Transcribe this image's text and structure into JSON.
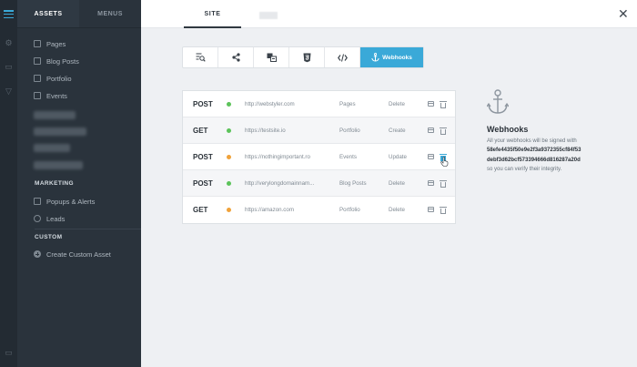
{
  "sidebar": {
    "tabs": [
      {
        "label": "ASSETS",
        "active": true
      },
      {
        "label": "MENUS",
        "active": false
      }
    ],
    "items": [
      {
        "label": "Pages",
        "icon": "page-icon"
      },
      {
        "label": "Blog Posts",
        "icon": "blog-icon"
      },
      {
        "label": "Portfolio",
        "icon": "portfolio-icon"
      },
      {
        "label": "Events",
        "icon": "calendar-icon"
      }
    ],
    "marketing_heading": "MARKETING",
    "marketing_items": [
      {
        "label": "Popups & Alerts",
        "icon": "popup-icon"
      },
      {
        "label": "Leads",
        "icon": "leads-icon"
      }
    ],
    "custom_heading": "CUSTOM",
    "custom_items": [
      {
        "label": "Create Custom Asset",
        "icon": "plus-circle-icon"
      }
    ]
  },
  "topbar": {
    "tab_site": "SITE",
    "close_glyph": "✕"
  },
  "toolbar": {
    "buttons": [
      {
        "icon": "search-doc-icon"
      },
      {
        "icon": "share-icon"
      },
      {
        "icon": "translate-icon"
      },
      {
        "icon": "css3-icon"
      },
      {
        "icon": "code-icon"
      },
      {
        "icon": "anchor-icon",
        "label": "Webhooks",
        "active": true
      }
    ]
  },
  "webhooks": {
    "rows": [
      {
        "method": "POST",
        "status": "green",
        "url": "http://webstyler.com",
        "asset": "Pages",
        "event": "Delete"
      },
      {
        "method": "GET",
        "status": "green",
        "url": "https://testsite.io",
        "asset": "Portfolio",
        "event": "Create"
      },
      {
        "method": "POST",
        "status": "orange",
        "url": "https://nothingimportant.ro",
        "asset": "Events",
        "event": "Update"
      },
      {
        "method": "POST",
        "status": "green",
        "url": "http://verylongdomainnam...",
        "asset": "Blog Posts",
        "event": "Delete"
      },
      {
        "method": "GET",
        "status": "orange",
        "url": "https://amazon.com",
        "asset": "Portfolio",
        "event": "Delete"
      }
    ]
  },
  "info": {
    "title": "Webhooks",
    "line1": "All your webhooks will be signed with",
    "hash1": "58efe4435f50e9e2f3a9372355cf84f53",
    "hash2": "debf3d62bcf573394666d816287a20d",
    "line2": "so you can verify their integrity."
  },
  "colors": {
    "accent": "#3aa9d8",
    "status_green": "#5cc35a",
    "status_orange": "#f0a23a",
    "sidebar_bg": "#2a333c"
  }
}
